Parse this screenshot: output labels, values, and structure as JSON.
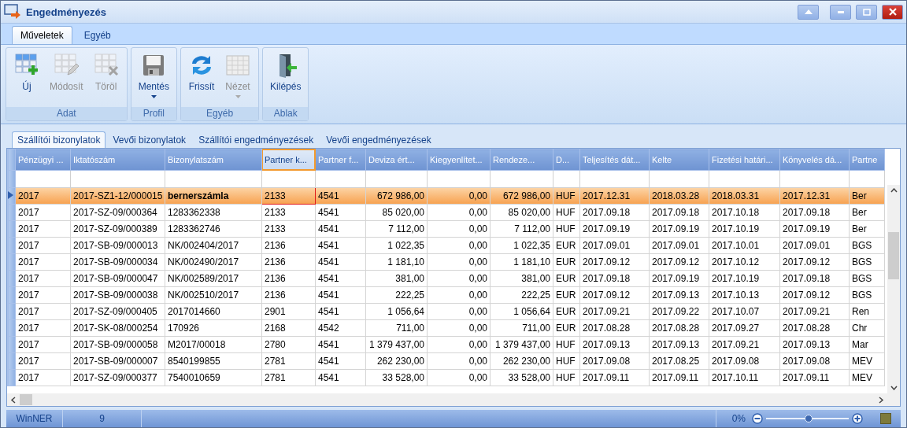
{
  "window": {
    "title": "Engedményezés"
  },
  "ribbon_tabs": [
    {
      "label": "Műveletek",
      "selected": true
    },
    {
      "label": "Egyéb",
      "selected": false
    }
  ],
  "ribbon_groups": [
    {
      "label": "Adat",
      "buttons": [
        {
          "kind": "new",
          "label": "Új",
          "disabled": false,
          "dropdown": false
        },
        {
          "kind": "edit",
          "label": "Módosít",
          "disabled": true,
          "dropdown": false
        },
        {
          "kind": "delete",
          "label": "Töröl",
          "disabled": true,
          "dropdown": false
        }
      ]
    },
    {
      "label": "Profil",
      "buttons": [
        {
          "kind": "save",
          "label": "Mentés",
          "disabled": false,
          "dropdown": true
        }
      ]
    },
    {
      "label": "Egyéb",
      "buttons": [
        {
          "kind": "refresh",
          "label": "Frissít",
          "disabled": false,
          "dropdown": false
        },
        {
          "kind": "view",
          "label": "Nézet",
          "disabled": true,
          "dropdown": true
        }
      ]
    },
    {
      "label": "Ablak",
      "buttons": [
        {
          "kind": "exit",
          "label": "Kilépés",
          "disabled": false,
          "dropdown": false
        }
      ]
    }
  ],
  "doc_tabs": [
    {
      "label": "Szállítói bizonylatok",
      "selected": true
    },
    {
      "label": "Vevői bizonylatok",
      "selected": false
    },
    {
      "label": "Szállítói engedményezések",
      "selected": false
    },
    {
      "label": "Vevői engedményezések",
      "selected": false
    }
  ],
  "table": {
    "columns": [
      {
        "label": "Pénzügyi ...",
        "focused": false
      },
      {
        "label": "Iktatószám",
        "focused": false
      },
      {
        "label": "Bizonylatszám",
        "focused": false
      },
      {
        "label": "Partner k...",
        "focused": true
      },
      {
        "label": "Partner f...",
        "focused": false
      },
      {
        "label": "Deviza ért...",
        "focused": false
      },
      {
        "label": "Kiegyenlítet...",
        "focused": false
      },
      {
        "label": "Rendeze...",
        "focused": false
      },
      {
        "label": "D...",
        "focused": false
      },
      {
        "label": "Teljesítés dát...",
        "focused": false
      },
      {
        "label": "Kelte",
        "focused": false
      },
      {
        "label": "Fizetési határi...",
        "focused": false
      },
      {
        "label": "Könyvelés dá...",
        "focused": false
      },
      {
        "label": "Partne",
        "focused": false
      }
    ],
    "rows": [
      {
        "selected": true,
        "cells": [
          "2017",
          "2017-SZ1-12/000015",
          "bernerszámla",
          "2133",
          "4541",
          "672 986,00",
          "0,00",
          "672 986,00",
          "HUF",
          "2017.12.31",
          "2018.03.28",
          "2018.03.31",
          "2017.12.31",
          "Ber"
        ]
      },
      {
        "selected": false,
        "cells": [
          "2017",
          "2017-SZ-09/000364",
          "1283362338",
          "2133",
          "4541",
          "85 020,00",
          "0,00",
          "85 020,00",
          "HUF",
          "2017.09.18",
          "2017.09.18",
          "2017.10.18",
          "2017.09.18",
          "Ber"
        ]
      },
      {
        "selected": false,
        "cells": [
          "2017",
          "2017-SZ-09/000389",
          "1283362746",
          "2133",
          "4541",
          "7 112,00",
          "0,00",
          "7 112,00",
          "HUF",
          "2017.09.19",
          "2017.09.19",
          "2017.10.19",
          "2017.09.19",
          "Ber"
        ]
      },
      {
        "selected": false,
        "cells": [
          "2017",
          "2017-SB-09/000013",
          "NK/002404/2017",
          "2136",
          "4541",
          "1 022,35",
          "0,00",
          "1 022,35",
          "EUR",
          "2017.09.01",
          "2017.09.01",
          "2017.10.01",
          "2017.09.01",
          "BGS"
        ]
      },
      {
        "selected": false,
        "cells": [
          "2017",
          "2017-SB-09/000034",
          "NK/002490/2017",
          "2136",
          "4541",
          "1 181,10",
          "0,00",
          "1 181,10",
          "EUR",
          "2017.09.12",
          "2017.09.12",
          "2017.10.12",
          "2017.09.12",
          "BGS"
        ]
      },
      {
        "selected": false,
        "cells": [
          "2017",
          "2017-SB-09/000047",
          "NK/002589/2017",
          "2136",
          "4541",
          "381,00",
          "0,00",
          "381,00",
          "EUR",
          "2017.09.18",
          "2017.09.19",
          "2017.10.19",
          "2017.09.18",
          "BGS"
        ]
      },
      {
        "selected": false,
        "cells": [
          "2017",
          "2017-SB-09/000038",
          "NK/002510/2017",
          "2136",
          "4541",
          "222,25",
          "0,00",
          "222,25",
          "EUR",
          "2017.09.12",
          "2017.09.13",
          "2017.10.13",
          "2017.09.12",
          "BGS"
        ]
      },
      {
        "selected": false,
        "cells": [
          "2017",
          "2017-SZ-09/000405",
          "2017014660",
          "2901",
          "4541",
          "1 056,64",
          "0,00",
          "1 056,64",
          "EUR",
          "2017.09.21",
          "2017.09.22",
          "2017.10.07",
          "2017.09.21",
          "Ren"
        ]
      },
      {
        "selected": false,
        "cells": [
          "2017",
          "2017-SK-08/000254",
          "170926",
          "2168",
          "4542",
          "711,00",
          "0,00",
          "711,00",
          "EUR",
          "2017.08.28",
          "2017.08.28",
          "2017.09.27",
          "2017.08.28",
          "Chr"
        ]
      },
      {
        "selected": false,
        "cells": [
          "2017",
          "2017-SB-09/000058",
          "M2017/00018",
          "2780",
          "4541",
          "1 379 437,00",
          "0,00",
          "1 379 437,00",
          "HUF",
          "2017.09.13",
          "2017.09.13",
          "2017.09.21",
          "2017.09.13",
          "Mar"
        ]
      },
      {
        "selected": false,
        "cells": [
          "2017",
          "2017-SB-09/000007",
          "8540199855",
          "2781",
          "4541",
          "262 230,00",
          "0,00",
          "262 230,00",
          "HUF",
          "2017.09.08",
          "2017.08.25",
          "2017.09.08",
          "2017.09.08",
          "MEV"
        ]
      },
      {
        "selected": false,
        "cells": [
          "2017",
          "2017-SZ-09/000377",
          "7540010659",
          "2781",
          "4541",
          "33 528,00",
          "0,00",
          "33 528,00",
          "HUF",
          "2017.09.11",
          "2017.09.11",
          "2017.10.11",
          "2017.09.11",
          "MEV"
        ]
      }
    ]
  },
  "status_bar": {
    "app": "WinNER",
    "count": "9",
    "zoom": {
      "reading": "0%",
      "level": 0.5
    }
  }
}
